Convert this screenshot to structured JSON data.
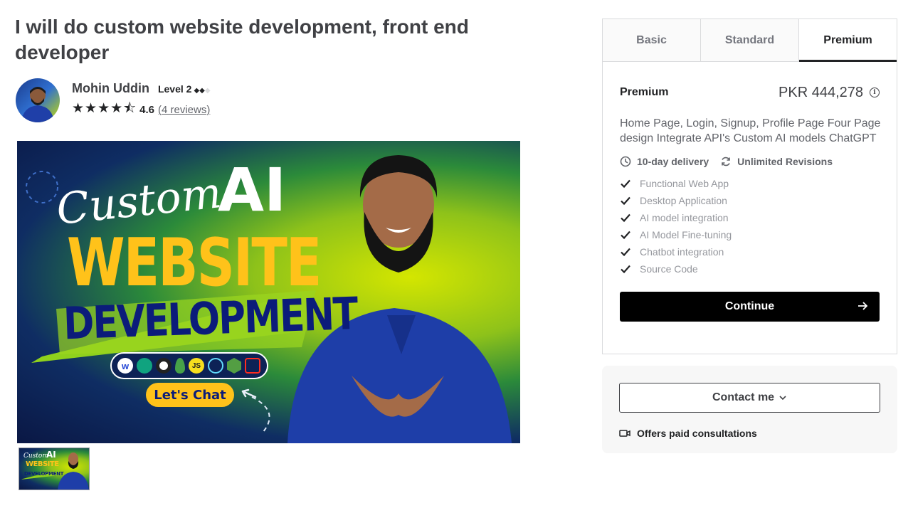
{
  "gig": {
    "title": "I will do custom website development, front end developer"
  },
  "seller": {
    "name": "Mohin Uddin",
    "level": "Level 2",
    "stars": "★★★★⯪",
    "rating": "4.6",
    "reviews": "(4 reviews)"
  },
  "gallery": {
    "hero_script_text": "Custom",
    "hero_ai_text": "AI",
    "hero_main_text": "WEBSITE",
    "hero_sub_text": "DEVELOPMENT",
    "hero_cta": "Let's Chat",
    "tech_icons": [
      "w",
      "JS"
    ],
    "thumb_script_text": "Custom",
    "thumb_ai_text": "AI",
    "thumb_main_text": "WEBSITE",
    "thumb_sub_text": "DEVELOPMENT"
  },
  "package": {
    "tabs": [
      "Basic",
      "Standard",
      "Premium"
    ],
    "active_tab": "Premium",
    "name": "Premium",
    "price": "PKR 444,278",
    "description": "Home Page, Login, Signup, Profile Page Four Page design Integrate API's Custom AI models ChatGPT",
    "delivery": "10-day delivery",
    "revisions": "Unlimited Revisions",
    "features": [
      "Functional Web App",
      "Desktop Application",
      "AI model integration",
      "AI Model Fine-tuning",
      "Chatbot integration",
      "Source Code"
    ],
    "continue_label": "Continue"
  },
  "contact": {
    "button_label": "Contact me",
    "consultation_text": "Offers paid consultations"
  },
  "colors": {
    "primary_text": "#404145",
    "muted_text": "#95979d",
    "button_bg": "#000000",
    "border": "#dadbdd",
    "hero_yellow": "#ffc21a",
    "hero_green": "#8ec21a"
  }
}
